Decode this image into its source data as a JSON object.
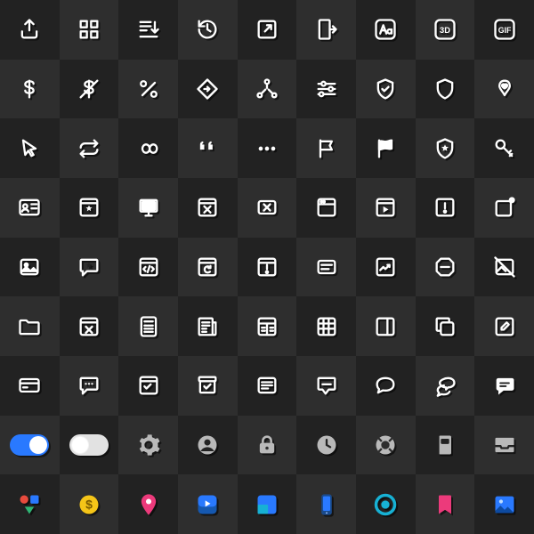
{
  "grid": {
    "rows": 9,
    "cols": 9,
    "pattern": "checkerboard",
    "colors": {
      "dark": "#222222",
      "light": "#2e2e2e"
    }
  },
  "icons": [
    [
      "upload",
      "grid-apps",
      "download-list",
      "history-reload",
      "open-external",
      "logout-door",
      "font-case",
      "badge-3d",
      "badge-gif"
    ],
    [
      "dollar",
      "dollar-off",
      "percent",
      "diamond-turn",
      "share-nodes",
      "sliders",
      "shield-check",
      "shield",
      "ribbon-heart"
    ],
    [
      "cursor-arrow",
      "repeat",
      "infinity",
      "quote",
      "ellipsis",
      "flag",
      "flag-wave",
      "shield-star",
      "key"
    ],
    [
      "id-card",
      "window-star",
      "monitor",
      "window-x",
      "rect-x",
      "browser",
      "video-play",
      "window-alert",
      "square-dot"
    ],
    [
      "image",
      "chat-star",
      "code-window",
      "browser-refresh",
      "window-warn",
      "panel-text",
      "chart-up",
      "stop-octagon",
      "image-off"
    ],
    [
      "folder",
      "calc-window",
      "calculator",
      "newspaper",
      "panel-split",
      "table",
      "sidebar",
      "copy",
      "edit-square"
    ],
    [
      "credit-card",
      "chat-dots-sq",
      "checklist",
      "archive-check",
      "list-panel",
      "chat-line",
      "chat-bubble",
      "chat-bubbles",
      "chat-fill"
    ],
    [
      "toggle-on",
      "toggle-off",
      "settings-gear",
      "user-circle",
      "lock",
      "clock",
      "life-ring",
      "book",
      "inbox"
    ],
    [
      "shapes",
      "coin-dollar",
      "pin",
      "play-app",
      "window-blue",
      "phone",
      "target",
      "bookmark",
      "photo"
    ]
  ],
  "row8_style": "grey-fill",
  "row9_style": "color",
  "colors": {
    "blue": "#2979ff",
    "yellow": "#f5c518",
    "pink": "#ec3a7b",
    "cyan": "#17b1d4",
    "green": "#2fb574",
    "red": "#e84b3d",
    "purple": "#8844dd"
  }
}
